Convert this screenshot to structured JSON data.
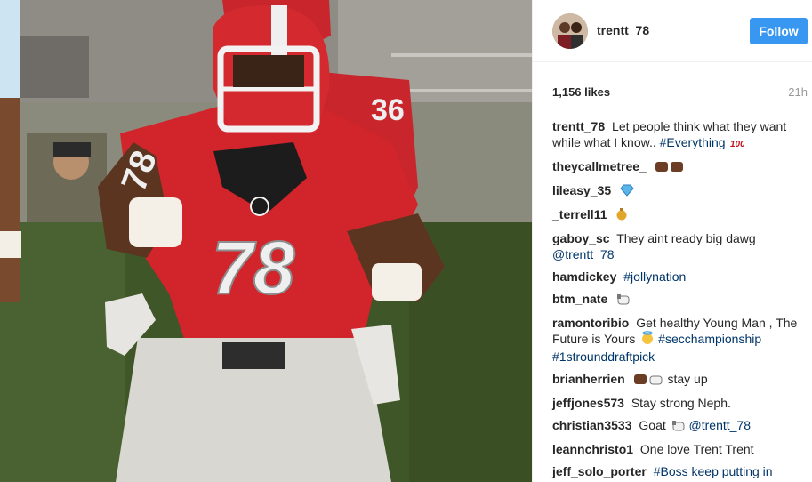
{
  "post": {
    "username": "trentt_78",
    "follow_label": "Follow",
    "likes": "1,156 likes",
    "time": "21h"
  },
  "photo": {
    "jersey_number": "78",
    "back_number": "36",
    "back_side_number": "78"
  },
  "comments": [
    {
      "user": "trentt_78",
      "text": "Let people think what they want while what I know..",
      "tags": "#Everything",
      "emoji": "hundred-points"
    },
    {
      "user": "theycallmetree_",
      "text": "",
      "tags": "",
      "emoji": "raised-fists"
    },
    {
      "user": "lileasy_35",
      "text": "",
      "tags": "",
      "emoji": "gem"
    },
    {
      "user": "_terrell11",
      "text": "",
      "tags": "",
      "emoji": "money-bag"
    },
    {
      "user": "gaboy_sc",
      "text": "They aint ready big dawg",
      "tags": "@trentt_78",
      "emoji": ""
    },
    {
      "user": "hamdickey",
      "text": "",
      "tags": "#jollynation",
      "emoji": ""
    },
    {
      "user": "btm_nate",
      "text": "",
      "tags": "",
      "emoji": "dog"
    },
    {
      "user": "ramontoribio",
      "text": "Get healthy Young Man , The Future is Yours",
      "emoji": "face-with-halo",
      "tags": "#secchampionship #1strounddraftpick"
    },
    {
      "user": "brianherrien",
      "text": "stay up",
      "tags": "",
      "emoji": "raised-fist-dog"
    },
    {
      "user": "jeffjones573",
      "text": "Stay strong Neph.",
      "tags": "",
      "emoji": ""
    },
    {
      "user": "christian3533",
      "text": "Goat",
      "tags": "@trentt_78",
      "emoji": "dog"
    },
    {
      "user": "leannchristo1",
      "text": "One love Trent Trent",
      "tags": "",
      "emoji": ""
    },
    {
      "user": "jeff_solo_porter",
      "text": "",
      "tags": "#Boss keep putting in",
      "emoji": ""
    }
  ],
  "colors": {
    "follow": "#3897f0",
    "hashtag": "#003569",
    "jersey": "#d2242b"
  }
}
